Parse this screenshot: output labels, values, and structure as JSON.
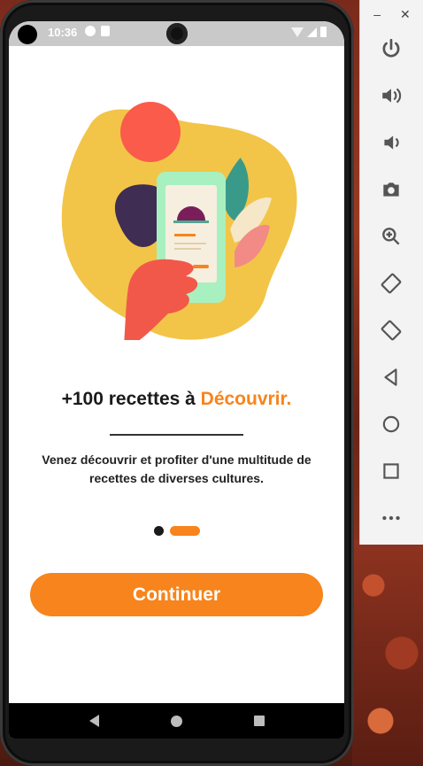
{
  "status_bar": {
    "time": "10:36"
  },
  "onboarding": {
    "headline_prefix": "+100 recettes à ",
    "headline_accent": "Découvrir.",
    "subtitle": "Venez découvrir et profiter d'une multitude de recettes de diverses cultures.",
    "page_index": 1,
    "page_count": 2,
    "continue_label": "Continuer"
  },
  "emulator_toolbar": {
    "minimize_label": "–",
    "close_label": "✕",
    "buttons": [
      "power-icon",
      "volume-up-icon",
      "volume-down-icon",
      "camera-icon",
      "zoom-icon",
      "rotate-left-icon",
      "rotate-right-icon",
      "back-icon",
      "home-icon",
      "overview-icon",
      "more-icon"
    ]
  },
  "colors": {
    "accent": "#f7841c",
    "illustration_blob": "#f2c548",
    "illustration_circle": "#fb5b4a",
    "phone_body": "#a8f0c0",
    "cloche": "#7a1e5a",
    "leaf_dark": "#3f2d53",
    "leaf_teal": "#3a9a8a",
    "leaf_pink": "#f28a86",
    "hand": "#f2584a"
  }
}
